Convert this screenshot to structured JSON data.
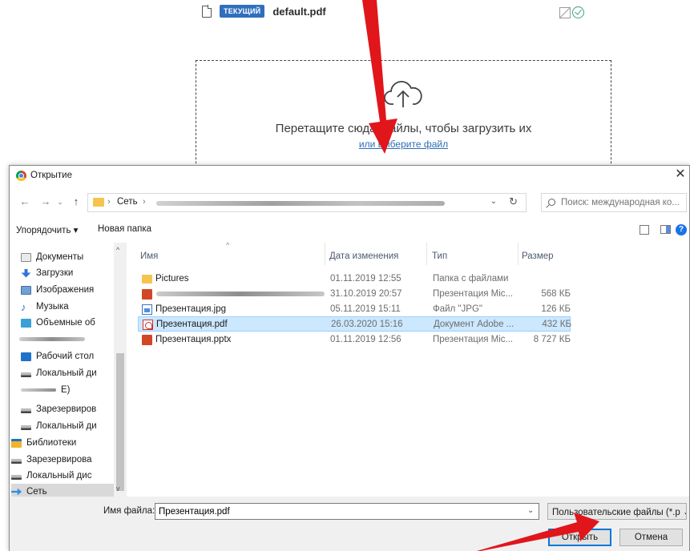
{
  "web_page": {
    "current_badge": "ТЕКУЩИЙ",
    "file_name": "default.pdf",
    "drop_text": "Перетащите сюда файлы, чтобы загрузить их",
    "drop_link": "или выберите файл",
    "icons": [
      "document-icon",
      "signature-off-icon",
      "check-circle-icon",
      "cloud-upload-icon"
    ]
  },
  "dialog": {
    "title": "Открытие",
    "address": {
      "segment": "Сеть",
      "sep": "›"
    },
    "search_placeholder": "Поиск: международная ко...",
    "toolbar": {
      "organize": "Упорядочить ▾",
      "new_folder": "Новая папка"
    },
    "nav_pane": [
      {
        "label": "Документы",
        "icon": "documents-icon"
      },
      {
        "label": "Загрузки",
        "icon": "downloads-icon"
      },
      {
        "label": "Изображения",
        "icon": "pictures-icon"
      },
      {
        "label": "Музыка",
        "icon": "music-icon"
      },
      {
        "label": "Объемные об",
        "icon": "3d-objects-icon"
      },
      {
        "label": "Рабочий стол",
        "icon": "desktop-icon"
      },
      {
        "label": "Локальный ди",
        "icon": "local-disk-icon"
      },
      {
        "label": "E)",
        "icon": "drive-icon"
      },
      {
        "label": "Зарезервиров",
        "icon": "drive-icon"
      },
      {
        "label": "Локальный ди",
        "icon": "drive-icon"
      },
      {
        "label": "Библиотеки",
        "icon": "libraries-icon"
      },
      {
        "label": "Зарезервирова",
        "icon": "drive-icon"
      },
      {
        "label": "Локальный дис",
        "icon": "drive-icon"
      },
      {
        "label": "Сеть",
        "icon": "network-icon"
      }
    ],
    "columns": {
      "name": "Имя",
      "date": "Дата изменения",
      "type": "Тип",
      "size": "Размер"
    },
    "files": [
      {
        "name": "Pictures",
        "date": "01.11.2019 12:55",
        "type": "Папка с файлами",
        "size": "",
        "icon": "folder-icon"
      },
      {
        "name": "",
        "date": "31.10.2019 20:57",
        "type": "Презентация Mic...",
        "size": "568 КБ",
        "icon": "powerpoint-icon"
      },
      {
        "name": "Презентация.jpg",
        "date": "05.11.2019 15:11",
        "type": "Файл \"JPG\"",
        "size": "126 КБ",
        "icon": "image-file-icon"
      },
      {
        "name": "Презентация.pdf",
        "date": "26.03.2020 15:16",
        "type": "Документ Adobe ...",
        "size": "432 КБ",
        "icon": "pdf-file-icon"
      },
      {
        "name": "Презентация.pptx",
        "date": "01.11.2019 12:56",
        "type": "Презентация Mic...",
        "size": "8 727 КБ",
        "icon": "powerpoint-icon"
      }
    ],
    "filename_label": "Имя файла:",
    "filename_value": "Презентация.pdf",
    "filter": "Пользовательские файлы (*.p",
    "open_button": "Открыть",
    "cancel_button": "Отмена"
  },
  "colors": {
    "annotation_arrow": "#e0161b",
    "link": "#2d6eb8",
    "badge": "#2f6fbd",
    "selection": "#cce8ff"
  }
}
